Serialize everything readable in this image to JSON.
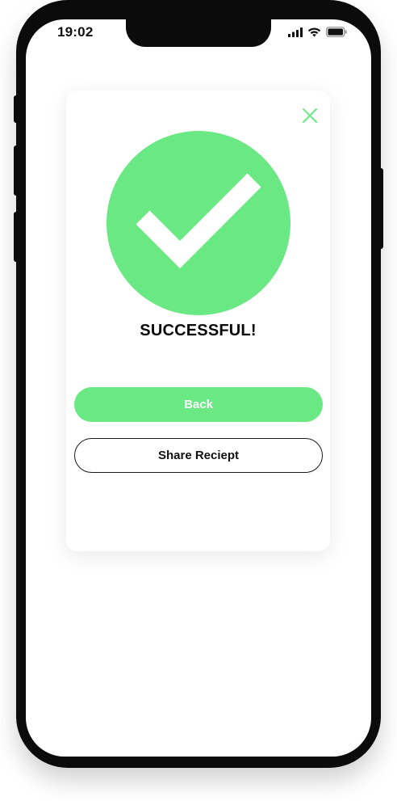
{
  "status_bar": {
    "time": "19:02",
    "icons": [
      "cellular-signal-icon",
      "wifi-icon",
      "battery-icon"
    ]
  },
  "modal": {
    "close_icon": "close-icon",
    "status_icon": "checkmark-icon",
    "title": "SUCCESSFUL!",
    "back_label": "Back",
    "share_label": "Share Reciept"
  },
  "colors": {
    "accent": "#6ae883",
    "text": "#0a0a0a",
    "phone_frame": "#0b0b0b",
    "background": "#ffffff"
  }
}
